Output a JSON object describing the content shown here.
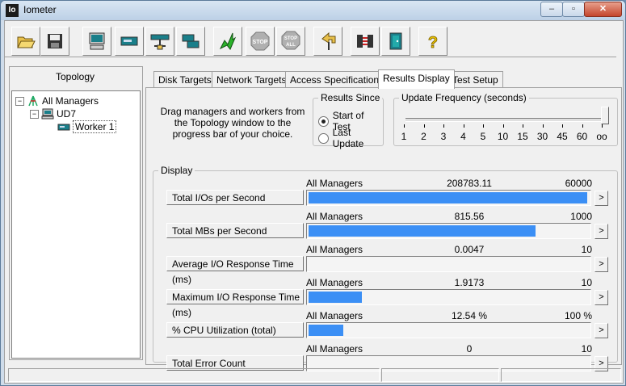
{
  "window": {
    "title": "Iometer",
    "app_icon": "Io"
  },
  "toolbar": {
    "buttons": [
      {
        "name": "open-config-icon"
      },
      {
        "name": "save-config-icon"
      },
      {
        "name": "start-display-manager-icon"
      },
      {
        "name": "new-disk-worker-icon"
      },
      {
        "name": "new-network-worker-icon"
      },
      {
        "name": "duplicate-worker-icon"
      },
      {
        "name": "start-test-icon"
      },
      {
        "name": "stop-icon",
        "label": "STOP"
      },
      {
        "name": "stop-all-icon",
        "label": "STOP ALL"
      },
      {
        "name": "reset-workers-icon"
      },
      {
        "name": "disconnect-managers-icon"
      },
      {
        "name": "exit-icon"
      },
      {
        "name": "about-icon",
        "label": "?"
      }
    ]
  },
  "topology": {
    "label": "Topology",
    "tree": [
      {
        "label": "All Managers",
        "expander": "−"
      },
      {
        "label": "UD7",
        "expander": "−"
      },
      {
        "label": "Worker 1"
      }
    ]
  },
  "tabs": [
    {
      "label": "Disk Targets"
    },
    {
      "label": "Network Targets"
    },
    {
      "label": "Access Specifications"
    },
    {
      "label": "Results Display",
      "active": true
    },
    {
      "label": "Test Setup"
    }
  ],
  "results": {
    "instructions": "Drag managers and workers from the Topology window to the progress bar of your choice.",
    "results_since": {
      "title": "Results Since",
      "options": [
        {
          "label": "Start of Test",
          "selected": true
        },
        {
          "label": "Last Update",
          "selected": false
        }
      ]
    },
    "update_frequency": {
      "title": "Update Frequency (seconds)",
      "ticks": [
        "1",
        "2",
        "3",
        "4",
        "5",
        "10",
        "15",
        "30",
        "45",
        "60",
        "oo"
      ],
      "selected": "oo"
    },
    "display": {
      "title": "Display",
      "metrics": [
        {
          "button": "Total I/Os per Second",
          "source": "All Managers",
          "value": "208783.11",
          "max": "60000",
          "fill": 1.0
        },
        {
          "button": "Total MBs per Second",
          "source": "All Managers",
          "value": "815.56",
          "max": "1000",
          "fill": 0.8156
        },
        {
          "button": "Average I/O Response Time (ms)",
          "source": "All Managers",
          "value": "0.0047",
          "max": "10",
          "fill": 0.0005
        },
        {
          "button": "Maximum I/O Response Time (ms)",
          "source": "All Managers",
          "value": "1.9173",
          "max": "10",
          "fill": 0.1917
        },
        {
          "button": "% CPU Utilization (total)",
          "source": "All Managers",
          "value": "12.54 %",
          "max": "100 %",
          "fill": 0.1254
        },
        {
          "button": "Total Error Count",
          "source": "All Managers",
          "value": "0",
          "max": "10",
          "fill": 0
        }
      ],
      "arrow": ">"
    }
  },
  "colors": {
    "bar_fill": "#3b8ff5",
    "background": "#f0f0f0"
  }
}
